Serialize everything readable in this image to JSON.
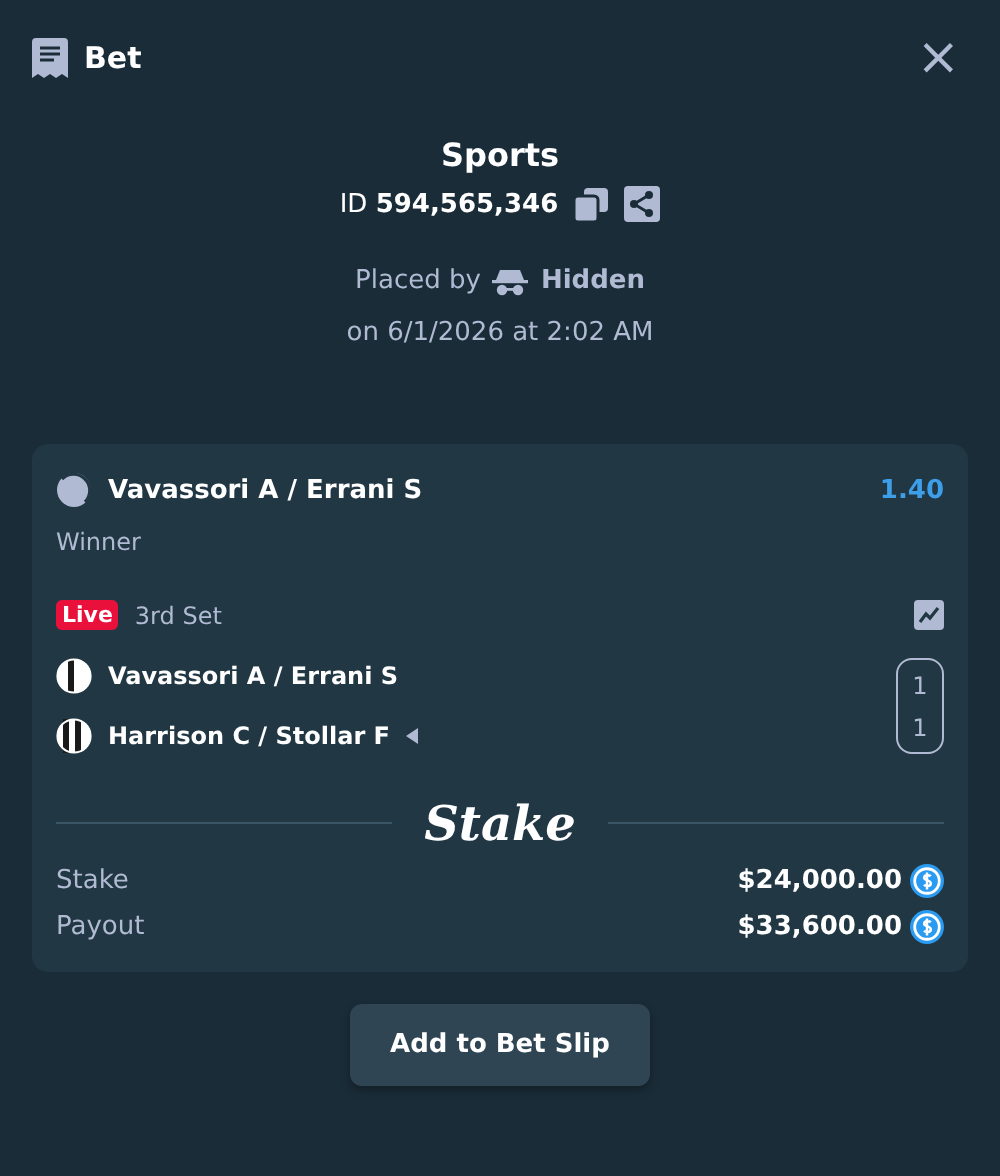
{
  "header": {
    "title": "Bet",
    "close": "×"
  },
  "summary": {
    "category": "Sports",
    "id_label": "ID",
    "id_value": "594,565,346",
    "placed_by_label": "Placed by",
    "placed_by_user": "Hidden",
    "placed_on": "on 6/1/2026 at 2:02 AM"
  },
  "selection": {
    "event": "Vavassori A / Errani S",
    "odds": "1.40",
    "market": "Winner",
    "live_badge": "Live",
    "period": "3rd Set",
    "teams": [
      {
        "name": "Vavassori A / Errani S",
        "score": "1",
        "serving": false
      },
      {
        "name": "Harrison C / Stollar F",
        "score": "1",
        "serving": true
      }
    ]
  },
  "brand": "Stake",
  "amounts": [
    {
      "label": "Stake",
      "value": "$24,000.00"
    },
    {
      "label": "Payout",
      "value": "$33,600.00"
    }
  ],
  "action_button": "Add to Bet Slip"
}
